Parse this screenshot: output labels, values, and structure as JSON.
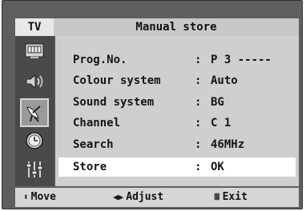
{
  "header": {
    "source": "TV",
    "title": "Manual store"
  },
  "sidebar": {
    "icons": [
      {
        "name": "picture-icon"
      },
      {
        "name": "sound-icon"
      },
      {
        "name": "channel-antenna-icon",
        "active": true
      },
      {
        "name": "time-clock-icon"
      },
      {
        "name": "setup-sliders-icon"
      }
    ]
  },
  "menu": {
    "rows": [
      {
        "label": "Prog.No.",
        "colon": ":",
        "value": "P 3 -----"
      },
      {
        "label": "Colour system",
        "colon": ":",
        "value": "Auto"
      },
      {
        "label": "Sound system",
        "colon": ":",
        "value": "BG"
      },
      {
        "label": "Channel",
        "colon": ":",
        "value": "C 1"
      },
      {
        "label": "Search",
        "colon": ":",
        "value": "46MHz"
      },
      {
        "label": "Store",
        "colon": ":",
        "value": "OK",
        "selected": true
      }
    ]
  },
  "footer": {
    "move": {
      "symbol": "⬍",
      "label": "Move"
    },
    "adjust": {
      "symbol": "◀▶",
      "label": "Adjust"
    },
    "exit": {
      "symbol": "Ⅲ",
      "label": "Exit"
    }
  },
  "colors": {
    "frame": "#5f5f5f",
    "sidebar": "#4a4a4a",
    "content": "#cfcfcf",
    "highlight": "#ffffff",
    "titlebar": "#c8c8c8"
  }
}
